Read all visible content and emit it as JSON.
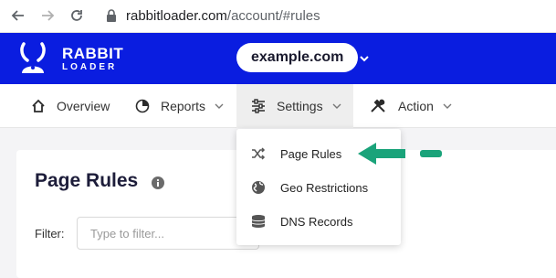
{
  "browser": {
    "url_host": "rabbitloader.com",
    "url_path": "/account/#rules"
  },
  "header": {
    "logo_line1": "RABBIT",
    "logo_line2": "LOADER",
    "domain": "example.com",
    "brand_color": "#0a1de0"
  },
  "menu": {
    "items": [
      {
        "label": "Overview",
        "icon": "home-icon"
      },
      {
        "label": "Reports",
        "icon": "pie-chart-icon"
      },
      {
        "label": "Settings",
        "icon": "sliders-icon"
      },
      {
        "label": "Action",
        "icon": "tools-icon"
      }
    ]
  },
  "dropdown": {
    "items": [
      {
        "label": "Page Rules",
        "icon": "shuffle-icon"
      },
      {
        "label": "Geo Restrictions",
        "icon": "globe-icon"
      },
      {
        "label": "DNS Records",
        "icon": "database-icon"
      }
    ]
  },
  "main": {
    "title": "Page Rules",
    "filter_label": "Filter:",
    "filter_placeholder": "Type to filter..."
  },
  "annotation": {
    "arrow_color": "#1aa37a"
  }
}
